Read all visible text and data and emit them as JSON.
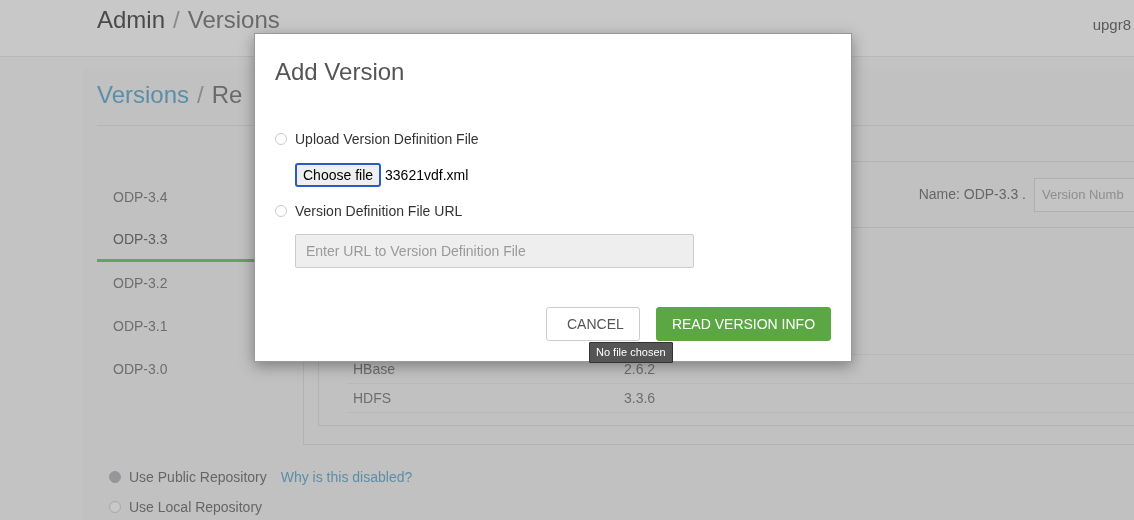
{
  "header": {
    "breadcrumb": [
      "Admin",
      "Versions"
    ],
    "separator": "/",
    "user": "upgr8"
  },
  "page": {
    "breadcrumb": [
      {
        "label": "Versions",
        "link": true
      },
      {
        "label": "Re",
        "link": false
      }
    ],
    "separator": "/",
    "stack_tabs": [
      {
        "label": "ODP-3.4",
        "selected": false
      },
      {
        "label": "ODP-3.3",
        "selected": true
      },
      {
        "label": "ODP-3.2",
        "selected": false
      },
      {
        "label": "ODP-3.1",
        "selected": false
      },
      {
        "label": "ODP-3.0",
        "selected": false
      }
    ],
    "name_label": "Name: ODP-3.3 .",
    "version_field": {
      "placeholder": "Version Numb"
    },
    "components": [
      {
        "name": "HBase",
        "version": "2.6.2"
      },
      {
        "name": "HDFS",
        "version": "3.3.6"
      }
    ],
    "repository_options": [
      {
        "label": "Use Public Repository",
        "selected": true,
        "help_link": "Why is this disabled?"
      },
      {
        "label": "Use Local Repository",
        "selected": false
      }
    ]
  },
  "modal": {
    "title": "Add Version",
    "options": [
      {
        "kind": "file",
        "label": "Upload Version Definition File",
        "selected": false,
        "button": "Choose file",
        "file_name": "33621vdf.xml"
      },
      {
        "kind": "url",
        "label": "Version Definition File URL",
        "selected": false,
        "placeholder": "Enter URL to Version Definition File"
      }
    ],
    "buttons": [
      {
        "label": "CANCEL",
        "kind": "secondary"
      },
      {
        "label": "READ VERSION INFO",
        "kind": "primary"
      }
    ],
    "tooltip": "No file chosen"
  }
}
